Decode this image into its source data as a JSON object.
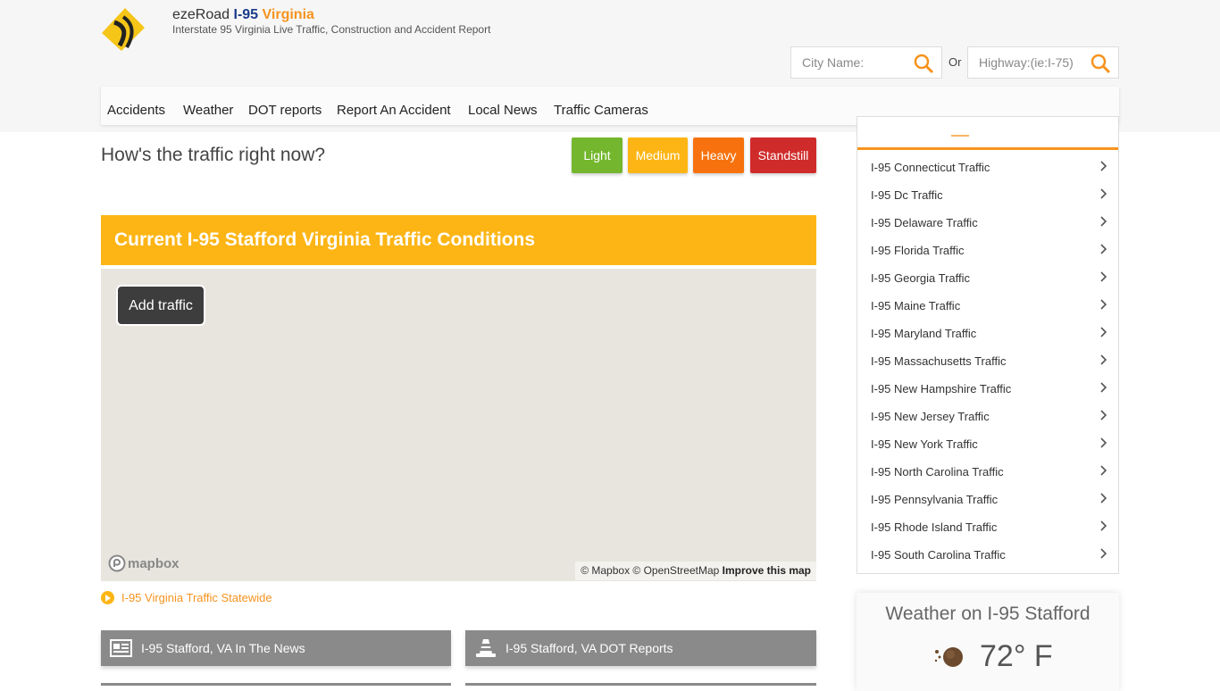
{
  "header": {
    "brand_name": "ezeRoad",
    "brand_highway": "I-95",
    "brand_state": "Virginia",
    "subtitle": "Interstate 95 Virginia Live Traffic, Construction and Accident Report",
    "city_placeholder": "City Name:",
    "highway_placeholder": "Highway:(ie:I-75)",
    "or_label": "Or"
  },
  "nav": {
    "items": [
      "Accidents",
      "Weather",
      "DOT reports",
      "Report An Accident",
      "Local News",
      "Traffic Cameras"
    ]
  },
  "traffic": {
    "question": "How's the traffic right now?",
    "buttons": [
      {
        "label": "Light",
        "color": "#74b72e"
      },
      {
        "label": "Medium",
        "color": "#fdb515"
      },
      {
        "label": "Heavy",
        "color": "#f7720e"
      },
      {
        "label": "Standstill",
        "color": "#d02b2b"
      }
    ]
  },
  "conditions": {
    "title": "Current I-95 Stafford Virginia Traffic Conditions"
  },
  "map": {
    "add_traffic": "Add traffic",
    "logo": "mapbox",
    "attribution": "© Mapbox © OpenStreetMap",
    "improve": "Improve this map"
  },
  "statewide_link": "I-95 Virginia Traffic Statewide",
  "sections": {
    "news": "I-95 Stafford, VA In The News",
    "dot": "I-95 Stafford, VA DOT Reports"
  },
  "sidebar": {
    "items": [
      "I-95 Connecticut Traffic",
      "I-95 Dc Traffic",
      "I-95 Delaware Traffic",
      "I-95 Florida Traffic",
      "I-95 Georgia Traffic",
      "I-95 Maine Traffic",
      "I-95 Maryland Traffic",
      "I-95 Massachusetts Traffic",
      "I-95 New Hampshire Traffic",
      "I-95 New Jersey Traffic",
      "I-95 New York Traffic",
      "I-95 North Carolina Traffic",
      "I-95 Pennsylvania Traffic",
      "I-95 Rhode Island Traffic",
      "I-95 South Carolina Traffic"
    ]
  },
  "weather": {
    "title": "Weather on I-95 Stafford",
    "temp": "72° F",
    "icon": "hazy-sun-icon"
  },
  "colors": {
    "accent_orange": "#f7931e",
    "accent_yellow": "#fdb515",
    "brand_blue": "#1b3b8a"
  }
}
